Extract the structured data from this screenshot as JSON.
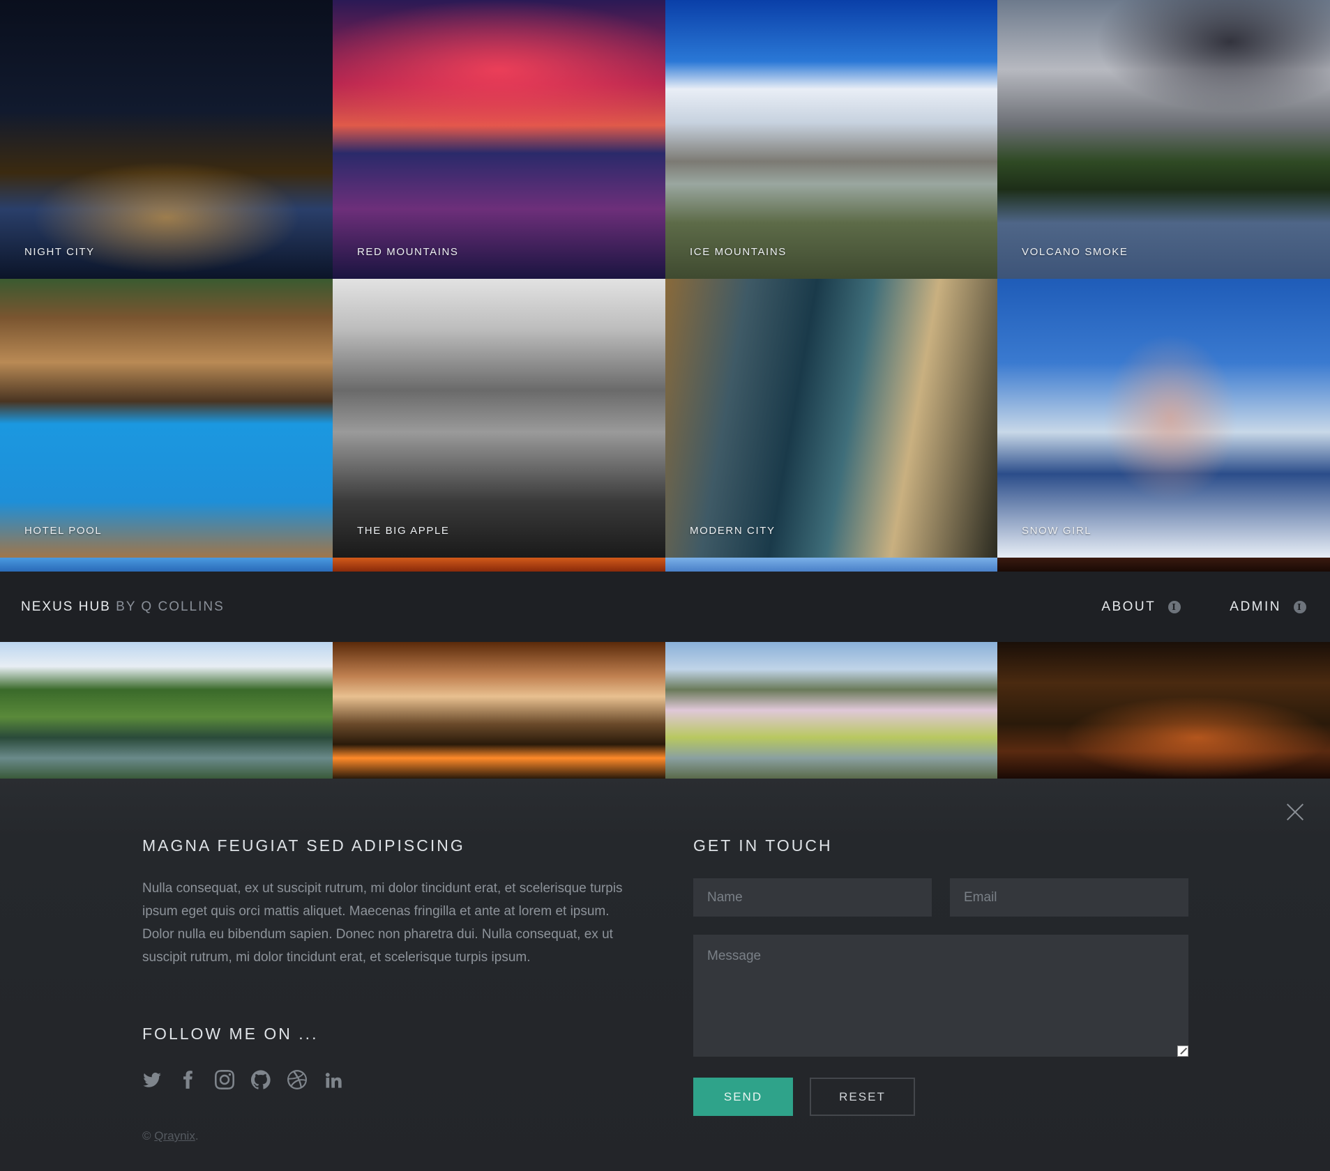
{
  "gallery": {
    "tiles": [
      {
        "label": "Night City"
      },
      {
        "label": "Red Mountains"
      },
      {
        "label": "Ice Mountains"
      },
      {
        "label": "Volcano Smoke"
      },
      {
        "label": "Hotel Pool"
      },
      {
        "label": "The Big Apple"
      },
      {
        "label": "Modern City"
      },
      {
        "label": "Snow Girl"
      }
    ]
  },
  "header": {
    "brand_name": "Nexus Hub",
    "brand_by": "by Q Collins",
    "nav": [
      {
        "label": "About",
        "icon": "info-icon"
      },
      {
        "label": "Admin",
        "icon": "info-icon"
      }
    ]
  },
  "footer": {
    "about_title": "Magna Feugiat Sed Adipiscing",
    "about_text": "Nulla consequat, ex ut suscipit rutrum, mi dolor tincidunt erat, et scelerisque turpis ipsum eget quis orci mattis aliquet. Maecenas fringilla et ante at lorem et ipsum. Dolor nulla eu bibendum sapien. Donec non pharetra dui. Nulla consequat, ex ut suscipit rutrum, mi dolor tincidunt erat, et scelerisque turpis ipsum.",
    "follow_title": "Follow me on ...",
    "social": [
      "twitter-icon",
      "facebook-icon",
      "instagram-icon",
      "github-icon",
      "dribbble-icon",
      "linkedin-icon"
    ],
    "copyright_symbol": "©",
    "copyright_link": "Qraynix",
    "copyright_end": ".",
    "contact_title": "Get in touch",
    "form": {
      "name_placeholder": "Name",
      "email_placeholder": "Email",
      "message_placeholder": "Message",
      "send_label": "Send",
      "reset_label": "Reset"
    }
  },
  "colors": {
    "accent": "#2fa38a",
    "background": "#1e2024"
  }
}
